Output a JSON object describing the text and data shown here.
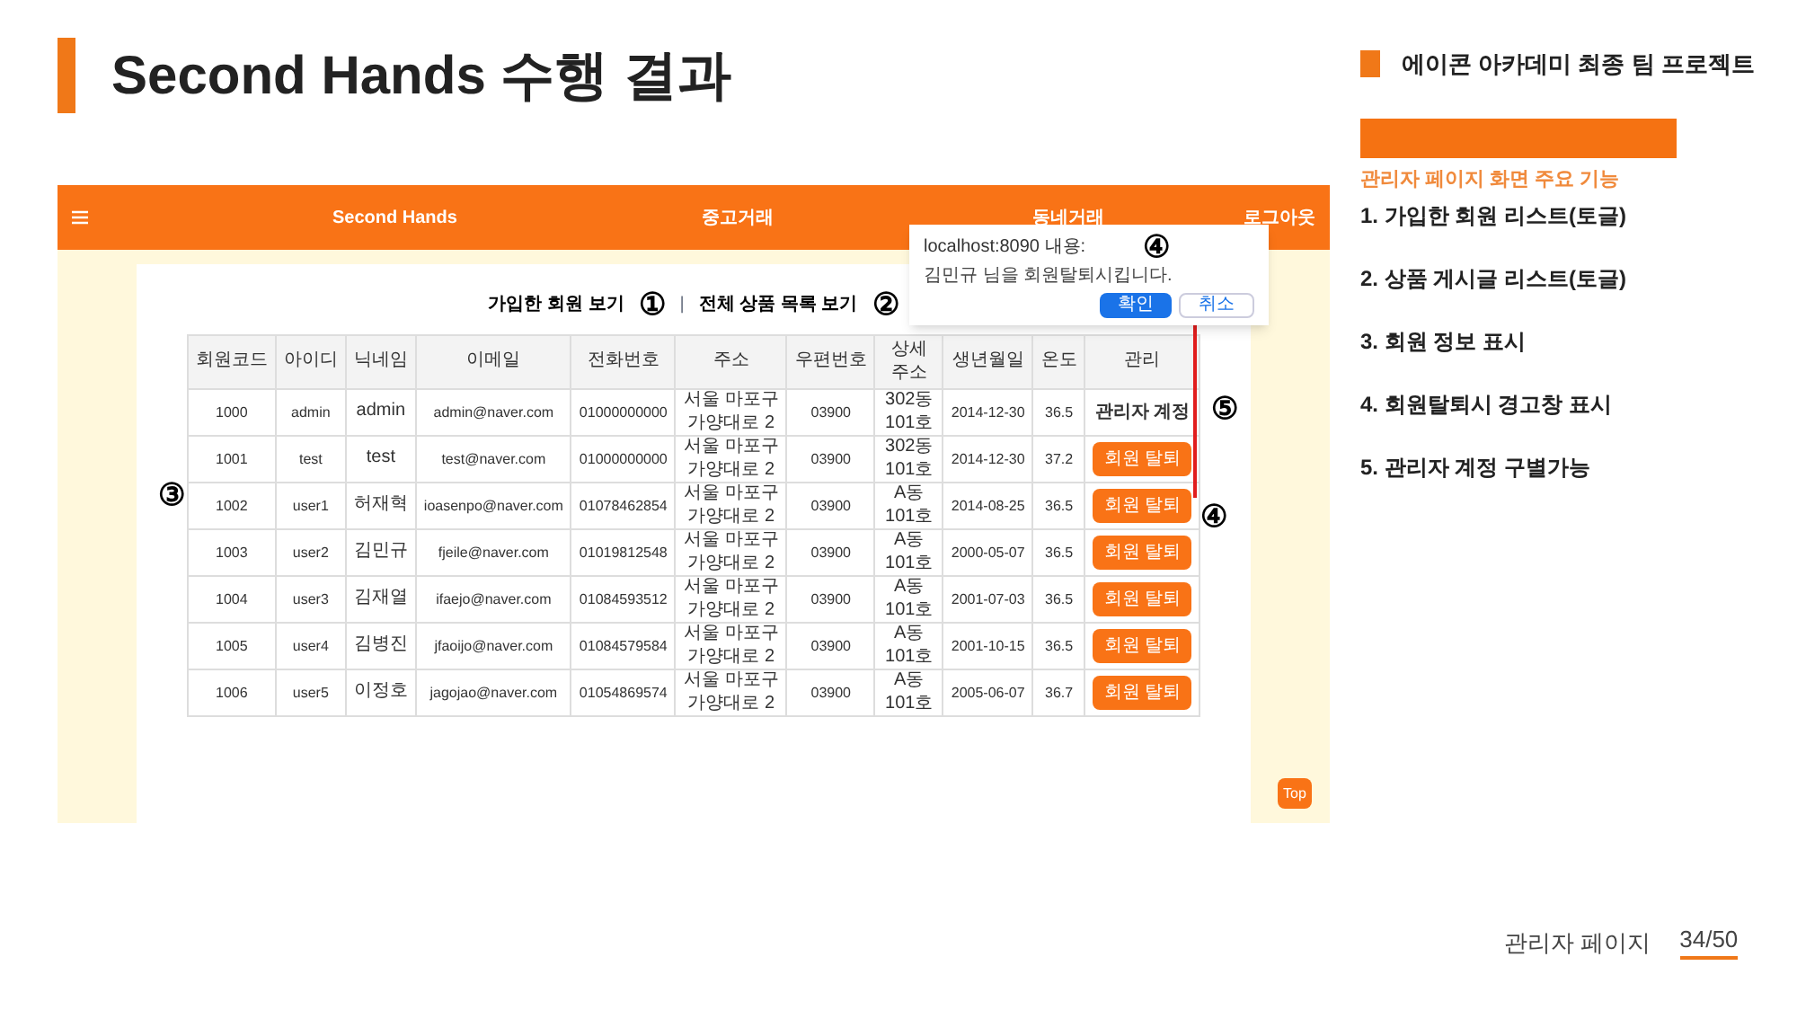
{
  "slide": {
    "title": "Second Hands 수행 결과",
    "subtitle": "에이콘 아카데미 최종 팀 프로젝트"
  },
  "nav": {
    "brand": "Second Hands",
    "links": [
      "중고거래",
      "동네거래"
    ],
    "logout": "로그아웃"
  },
  "admin_tabs": [
    "가입한 회원 보기",
    "전체 상품 목록 보기"
  ],
  "tab_separator": "|",
  "table": {
    "columns": [
      "회원코드",
      "아이디",
      "닉네임",
      "이메일",
      "전화번호",
      "주소",
      "우편번호",
      "상세주소",
      "생년월일",
      "온도",
      "관리"
    ],
    "rows": [
      {
        "cells": [
          "1000",
          "admin",
          "admin",
          "admin@naver.com",
          "01000000000",
          "서울 마포구 가양대로 2",
          "03900",
          "302동 101호",
          "2014-12-30",
          "36.5"
        ],
        "manage": {
          "kind": "label",
          "text": "관리자 계정"
        }
      },
      {
        "cells": [
          "1001",
          "test",
          "test",
          "test@naver.com",
          "01000000000",
          "서울 마포구 가양대로 2",
          "03900",
          "302동 101호",
          "2014-12-30",
          "37.2"
        ],
        "manage": {
          "kind": "button",
          "text": "회원 탈퇴"
        }
      },
      {
        "cells": [
          "1002",
          "user1",
          "허재혁",
          "ioasenpo@naver.com",
          "01078462854",
          "서울 마포구 가양대로 2",
          "03900",
          "A동 101호",
          "2014-08-25",
          "36.5"
        ],
        "manage": {
          "kind": "button",
          "text": "회원 탈퇴"
        }
      },
      {
        "cells": [
          "1003",
          "user2",
          "김민규",
          "fjeile@naver.com",
          "01019812548",
          "서울 마포구 가양대로 2",
          "03900",
          "A동 101호",
          "2000-05-07",
          "36.5"
        ],
        "manage": {
          "kind": "button",
          "text": "회원 탈퇴"
        }
      },
      {
        "cells": [
          "1004",
          "user3",
          "김재열",
          "ifaejo@naver.com",
          "01084593512",
          "서울 마포구 가양대로 2",
          "03900",
          "A동 101호",
          "2001-07-03",
          "36.5"
        ],
        "manage": {
          "kind": "button",
          "text": "회원 탈퇴"
        }
      },
      {
        "cells": [
          "1005",
          "user4",
          "김병진",
          "jfaoijo@naver.com",
          "01084579584",
          "서울 마포구 가양대로 2",
          "03900",
          "A동 101호",
          "2001-10-15",
          "36.5"
        ],
        "manage": {
          "kind": "button",
          "text": "회원 탈퇴"
        }
      },
      {
        "cells": [
          "1006",
          "user5",
          "이정호",
          "jagojao@naver.com",
          "01054869574",
          "서울 마포구 가양대로 2",
          "03900",
          "A동 101호",
          "2005-06-07",
          "36.7"
        ],
        "manage": {
          "kind": "button",
          "text": "회원 탈퇴"
        }
      }
    ]
  },
  "dialog": {
    "origin": "localhost:8090 내용:",
    "message": "김민규 님을 회원탈퇴시킵니다.",
    "ok": "확인",
    "cancel": "취소"
  },
  "top_button": "Top",
  "annotations": [
    "①",
    "②",
    "③",
    "④",
    "④",
    "⑤"
  ],
  "features": {
    "heading": "관리자 페이지 화면 주요 기능",
    "items": [
      "1. 가입한 회원 리스트(토글)",
      "2. 상품 게시글 리스트(토글)",
      "3. 회원 정보 표시",
      "4. 회원탈퇴시 경고창 표시",
      "5. 관리자 계정 구별가능"
    ]
  },
  "footer": {
    "section": "관리자 페이지",
    "page": "34/50"
  }
}
